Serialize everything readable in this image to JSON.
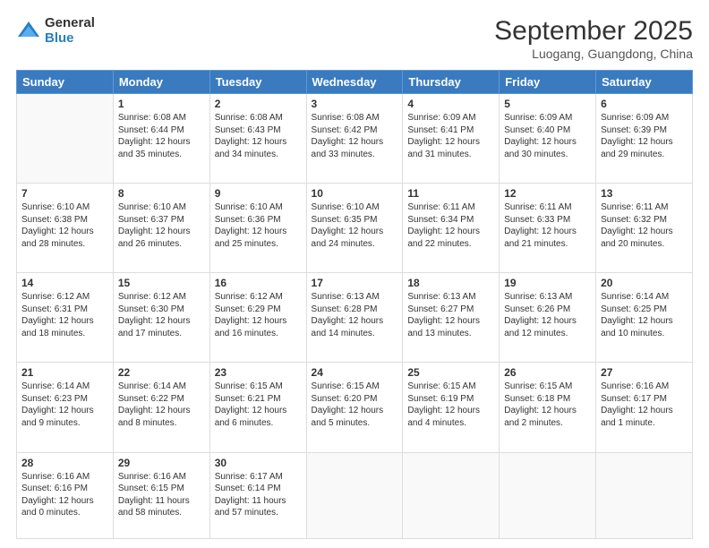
{
  "logo": {
    "general": "General",
    "blue": "Blue"
  },
  "title": "September 2025",
  "location": "Luogang, Guangdong, China",
  "days_of_week": [
    "Sunday",
    "Monday",
    "Tuesday",
    "Wednesday",
    "Thursday",
    "Friday",
    "Saturday"
  ],
  "weeks": [
    [
      {
        "day": "",
        "info": ""
      },
      {
        "day": "1",
        "info": "Sunrise: 6:08 AM\nSunset: 6:44 PM\nDaylight: 12 hours\nand 35 minutes."
      },
      {
        "day": "2",
        "info": "Sunrise: 6:08 AM\nSunset: 6:43 PM\nDaylight: 12 hours\nand 34 minutes."
      },
      {
        "day": "3",
        "info": "Sunrise: 6:08 AM\nSunset: 6:42 PM\nDaylight: 12 hours\nand 33 minutes."
      },
      {
        "day": "4",
        "info": "Sunrise: 6:09 AM\nSunset: 6:41 PM\nDaylight: 12 hours\nand 31 minutes."
      },
      {
        "day": "5",
        "info": "Sunrise: 6:09 AM\nSunset: 6:40 PM\nDaylight: 12 hours\nand 30 minutes."
      },
      {
        "day": "6",
        "info": "Sunrise: 6:09 AM\nSunset: 6:39 PM\nDaylight: 12 hours\nand 29 minutes."
      }
    ],
    [
      {
        "day": "7",
        "info": "Sunrise: 6:10 AM\nSunset: 6:38 PM\nDaylight: 12 hours\nand 28 minutes."
      },
      {
        "day": "8",
        "info": "Sunrise: 6:10 AM\nSunset: 6:37 PM\nDaylight: 12 hours\nand 26 minutes."
      },
      {
        "day": "9",
        "info": "Sunrise: 6:10 AM\nSunset: 6:36 PM\nDaylight: 12 hours\nand 25 minutes."
      },
      {
        "day": "10",
        "info": "Sunrise: 6:10 AM\nSunset: 6:35 PM\nDaylight: 12 hours\nand 24 minutes."
      },
      {
        "day": "11",
        "info": "Sunrise: 6:11 AM\nSunset: 6:34 PM\nDaylight: 12 hours\nand 22 minutes."
      },
      {
        "day": "12",
        "info": "Sunrise: 6:11 AM\nSunset: 6:33 PM\nDaylight: 12 hours\nand 21 minutes."
      },
      {
        "day": "13",
        "info": "Sunrise: 6:11 AM\nSunset: 6:32 PM\nDaylight: 12 hours\nand 20 minutes."
      }
    ],
    [
      {
        "day": "14",
        "info": "Sunrise: 6:12 AM\nSunset: 6:31 PM\nDaylight: 12 hours\nand 18 minutes."
      },
      {
        "day": "15",
        "info": "Sunrise: 6:12 AM\nSunset: 6:30 PM\nDaylight: 12 hours\nand 17 minutes."
      },
      {
        "day": "16",
        "info": "Sunrise: 6:12 AM\nSunset: 6:29 PM\nDaylight: 12 hours\nand 16 minutes."
      },
      {
        "day": "17",
        "info": "Sunrise: 6:13 AM\nSunset: 6:28 PM\nDaylight: 12 hours\nand 14 minutes."
      },
      {
        "day": "18",
        "info": "Sunrise: 6:13 AM\nSunset: 6:27 PM\nDaylight: 12 hours\nand 13 minutes."
      },
      {
        "day": "19",
        "info": "Sunrise: 6:13 AM\nSunset: 6:26 PM\nDaylight: 12 hours\nand 12 minutes."
      },
      {
        "day": "20",
        "info": "Sunrise: 6:14 AM\nSunset: 6:25 PM\nDaylight: 12 hours\nand 10 minutes."
      }
    ],
    [
      {
        "day": "21",
        "info": "Sunrise: 6:14 AM\nSunset: 6:23 PM\nDaylight: 12 hours\nand 9 minutes."
      },
      {
        "day": "22",
        "info": "Sunrise: 6:14 AM\nSunset: 6:22 PM\nDaylight: 12 hours\nand 8 minutes."
      },
      {
        "day": "23",
        "info": "Sunrise: 6:15 AM\nSunset: 6:21 PM\nDaylight: 12 hours\nand 6 minutes."
      },
      {
        "day": "24",
        "info": "Sunrise: 6:15 AM\nSunset: 6:20 PM\nDaylight: 12 hours\nand 5 minutes."
      },
      {
        "day": "25",
        "info": "Sunrise: 6:15 AM\nSunset: 6:19 PM\nDaylight: 12 hours\nand 4 minutes."
      },
      {
        "day": "26",
        "info": "Sunrise: 6:15 AM\nSunset: 6:18 PM\nDaylight: 12 hours\nand 2 minutes."
      },
      {
        "day": "27",
        "info": "Sunrise: 6:16 AM\nSunset: 6:17 PM\nDaylight: 12 hours\nand 1 minute."
      }
    ],
    [
      {
        "day": "28",
        "info": "Sunrise: 6:16 AM\nSunset: 6:16 PM\nDaylight: 12 hours\nand 0 minutes."
      },
      {
        "day": "29",
        "info": "Sunrise: 6:16 AM\nSunset: 6:15 PM\nDaylight: 11 hours\nand 58 minutes."
      },
      {
        "day": "30",
        "info": "Sunrise: 6:17 AM\nSunset: 6:14 PM\nDaylight: 11 hours\nand 57 minutes."
      },
      {
        "day": "",
        "info": ""
      },
      {
        "day": "",
        "info": ""
      },
      {
        "day": "",
        "info": ""
      },
      {
        "day": "",
        "info": ""
      }
    ]
  ]
}
